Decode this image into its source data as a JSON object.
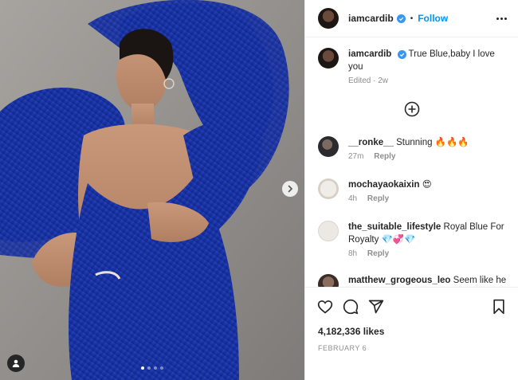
{
  "post": {
    "username": "iamcardib",
    "separator": "•",
    "follow_label": "Follow",
    "caption": {
      "username": "iamcardib",
      "text": "True Blue,baby I love you",
      "edited": "Edited",
      "age": "2w"
    },
    "comments": [
      {
        "username": "__ronke__",
        "text": "Stunning 🔥🔥🔥",
        "age": "27m",
        "reply": "Reply"
      },
      {
        "username": "mochayaokaixin",
        "text": "😍",
        "age": "4h",
        "reply": "Reply"
      },
      {
        "username": "the_suitable_lifestyle",
        "text": "Royal Blue For Royalty 💎💞💎",
        "age": "8h",
        "reply": "Reply"
      },
      {
        "username": "matthew_grogeous_leo",
        "text": "Seem like he"
      }
    ],
    "likes": "4,182,336 likes",
    "date": "FEBRUARY 6",
    "carousel": {
      "count": 4,
      "active": 0
    }
  },
  "icons": {
    "more": "more-options-icon",
    "verified": "verified-badge-icon",
    "load_more": "plus-circle-icon",
    "like": "heart-icon",
    "comment": "comment-icon",
    "share": "share-icon",
    "save": "bookmark-icon",
    "next": "chevron-right-icon",
    "tag": "user-tag-icon"
  },
  "colors": {
    "accent": "#0095f6",
    "verified": "#3897f0",
    "dress_blue": "#1f3fb0",
    "muted": "#8e8e8e"
  }
}
